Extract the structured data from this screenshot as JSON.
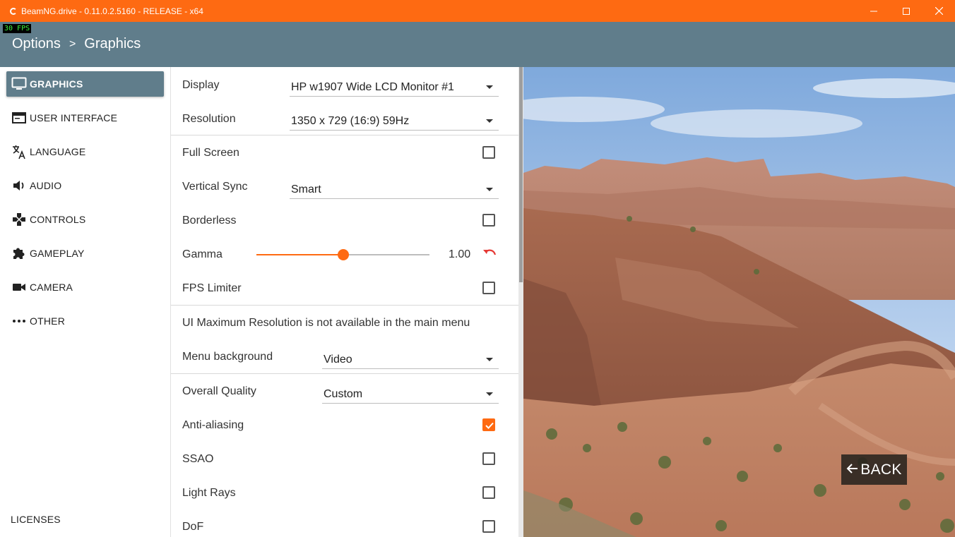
{
  "window": {
    "title": "BeamNG.drive - 0.11.0.2.5160 - RELEASE - x64"
  },
  "fps_counter": "30 FPS",
  "breadcrumb": {
    "root": "Options",
    "separator": ">",
    "current": "Graphics"
  },
  "sidebar": {
    "items": [
      {
        "label": "GRAPHICS",
        "icon": "monitor-icon",
        "active": true
      },
      {
        "label": "USER INTERFACE",
        "icon": "window-icon",
        "active": false
      },
      {
        "label": "LANGUAGE",
        "icon": "translate-icon",
        "active": false
      },
      {
        "label": "AUDIO",
        "icon": "speaker-icon",
        "active": false
      },
      {
        "label": "CONTROLS",
        "icon": "gamepad-icon",
        "active": false
      },
      {
        "label": "GAMEPLAY",
        "icon": "puzzle-icon",
        "active": false
      },
      {
        "label": "CAMERA",
        "icon": "video-camera-icon",
        "active": false
      },
      {
        "label": "OTHER",
        "icon": "more-dots-icon",
        "active": false
      }
    ],
    "licenses": "LICENSES"
  },
  "settings": {
    "display": {
      "label": "Display",
      "value": "HP w1907 Wide LCD Monitor #1"
    },
    "resolution": {
      "label": "Resolution",
      "value": "1350 x 729 (16:9) 59Hz"
    },
    "full_screen": {
      "label": "Full Screen",
      "checked": false
    },
    "vertical_sync": {
      "label": "Vertical Sync",
      "value": "Smart"
    },
    "borderless": {
      "label": "Borderless",
      "checked": false
    },
    "gamma": {
      "label": "Gamma",
      "value": "1.00",
      "fraction": 0.5
    },
    "fps_limiter": {
      "label": "FPS Limiter",
      "checked": false
    },
    "ui_max_res_note": "UI Maximum Resolution is not available in the main menu",
    "menu_background": {
      "label": "Menu background",
      "value": "Video"
    },
    "overall_quality": {
      "label": "Overall Quality",
      "value": "Custom"
    },
    "anti_aliasing": {
      "label": "Anti-aliasing",
      "checked": true
    },
    "ssao": {
      "label": "SSAO",
      "checked": false
    },
    "light_rays": {
      "label": "Light Rays",
      "checked": false
    },
    "dof": {
      "label": "DoF",
      "checked": false
    }
  },
  "back_button": {
    "label": "BACK"
  },
  "colors": {
    "accent": "#fe6a12",
    "header": "#607d8b"
  }
}
